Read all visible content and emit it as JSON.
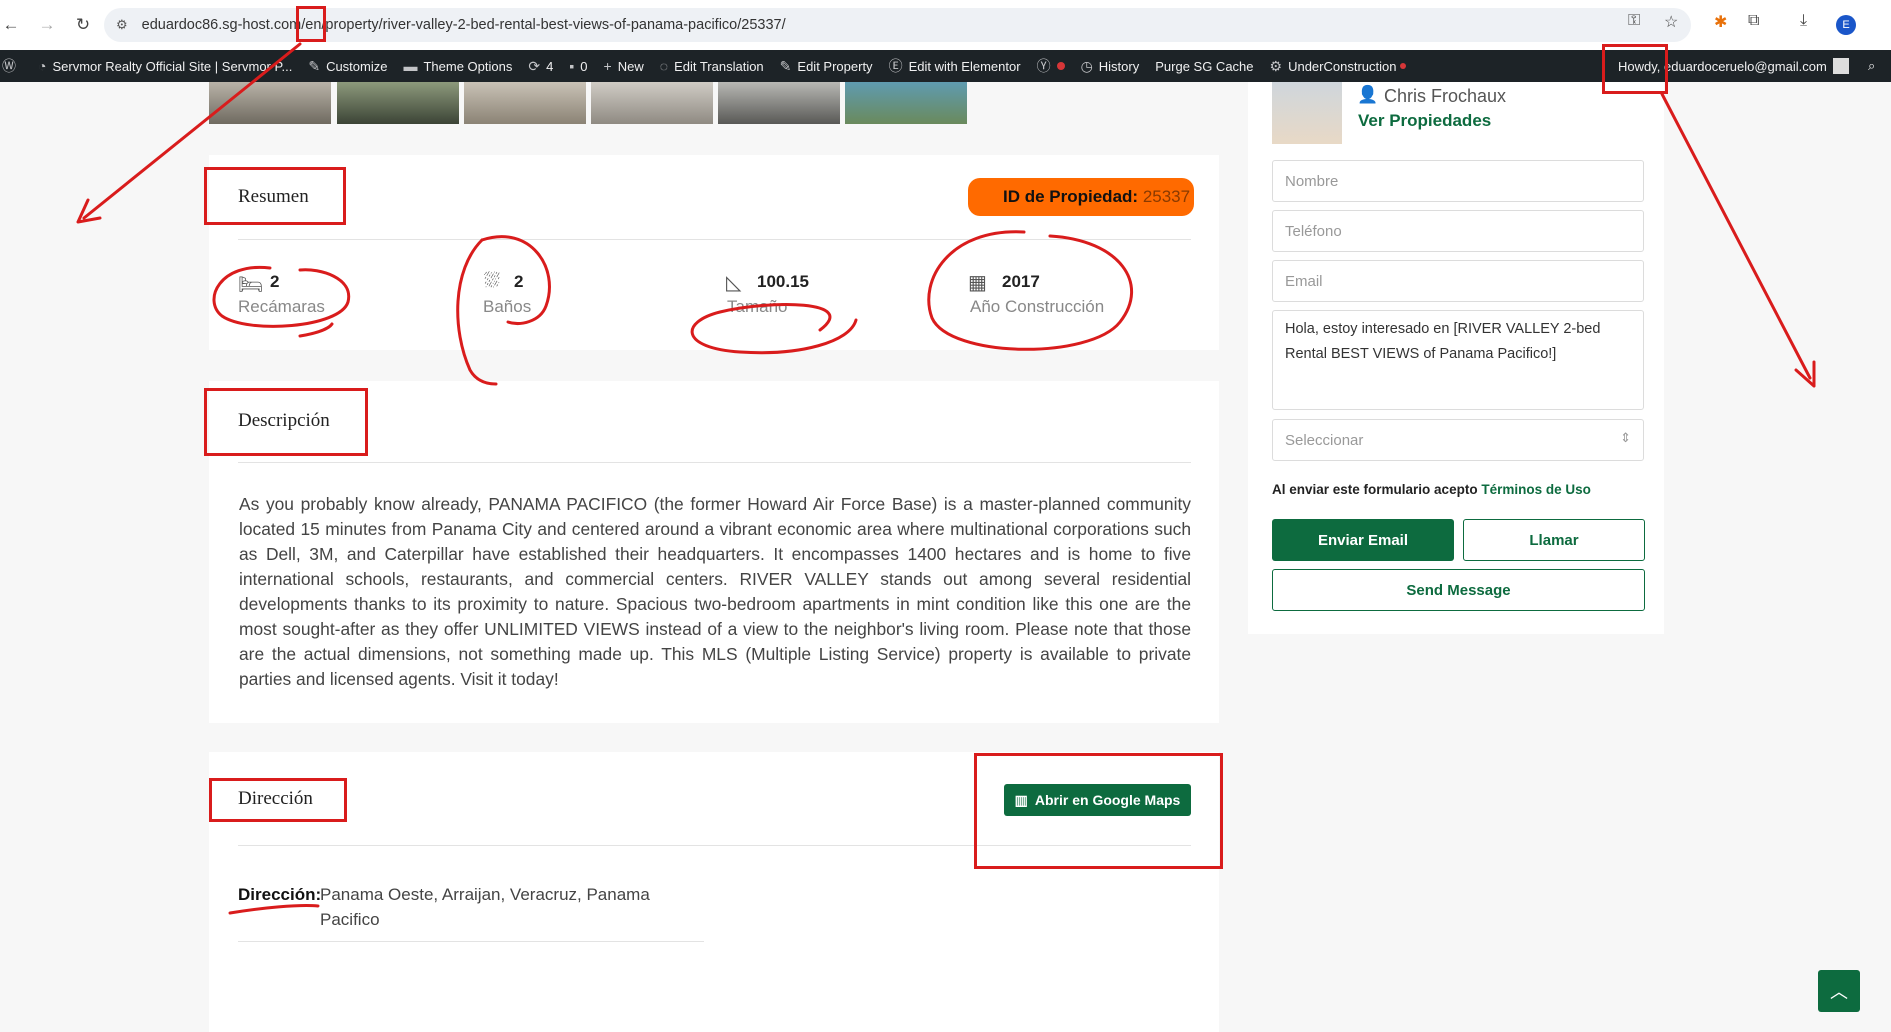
{
  "browser": {
    "url": "eduardoc86.sg-host.com/en/property/river-valley-2-bed-rental-best-views-of-panama-pacifico/25337/",
    "avatar_letter": "E"
  },
  "wp_admin_bar": {
    "site_name": "Servmor Realty Official Site | Servmor P...",
    "customize": "Customize",
    "theme_options": "Theme Options",
    "updates_count": "4",
    "comments_count": "0",
    "new": "New",
    "edit_translation": "Edit Translation",
    "edit_property": "Edit Property",
    "edit_elementor": "Edit with Elementor",
    "history": "History",
    "purge_cache": "Purge SG Cache",
    "under_construction": "UnderConstruction",
    "howdy": "Howdy, eduardoceruelo@gmail.com"
  },
  "summary": {
    "title": "Resumen",
    "property_id_label": "ID de Propiedad:",
    "property_id_value": "25337",
    "stats": [
      {
        "value": "2",
        "label": "Recámaras"
      },
      {
        "value": "2",
        "label": "Baños"
      },
      {
        "value": "100.15",
        "label": "Tamaño"
      },
      {
        "value": "2017",
        "label": "Año Construcción"
      }
    ]
  },
  "description": {
    "title": "Descripción",
    "text": "As you probably know already, PANAMA PACIFICO (the former Howard Air Force Base) is a master-planned community located 15 minutes from Panama City and centered around a vibrant economic area where multinational corporations such as Dell, 3M, and Caterpillar have established their headquarters. It encompasses 1400 hectares and is home to five international schools, restaurants, and commercial centers. RIVER VALLEY stands out among several residential developments thanks to its proximity to nature. Spacious two-bedroom apartments in mint condition like this one are the most sought-after as they offer UNLIMITED VIEWS instead of a view to the neighbor's living room. Please note that those are the actual dimensions, not something made up. This MLS (Multiple Listing Service) property is available to private parties and licensed agents. Visit it today!"
  },
  "address": {
    "title": "Dirección",
    "maps_button": "Abrir en Google Maps",
    "label": "Dirección:",
    "value_line1": "Panama Oeste, Arraijan, Veracruz, Panama",
    "value_line2": "Pacifico"
  },
  "agent": {
    "name": "Chris Frochaux",
    "link": "Ver Propiedades"
  },
  "contact_form": {
    "name_placeholder": "Nombre",
    "phone_placeholder": "Teléfono",
    "email_placeholder": "Email",
    "message_line1": "Hola, estoy interesado en [RIVER VALLEY 2-bed",
    "message_line2": "Rental BEST VIEWS of Panama Pacifico!]",
    "select_placeholder": "Seleccionar",
    "terms_text": "Al enviar este formulario acepto",
    "terms_link": "Términos de Uso",
    "send_email": "Enviar Email",
    "call": "Llamar",
    "send_message": "Send Message"
  },
  "colors": {
    "accent_green": "#0d6b3f",
    "annotation_red": "#d91c1c",
    "highlight_orange": "#ff6a00"
  }
}
